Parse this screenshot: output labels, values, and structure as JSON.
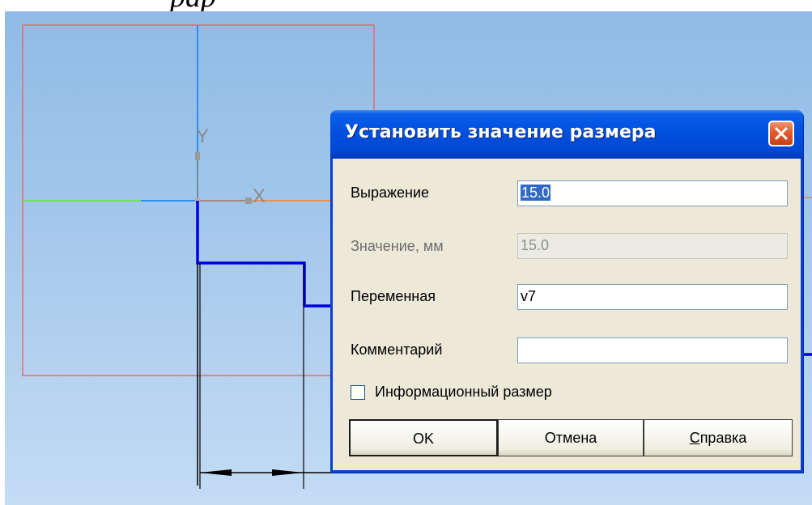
{
  "caption": "рар",
  "dialog": {
    "title": "Установить значение размера",
    "close_icon": "close-icon",
    "fields": {
      "expression": {
        "label": "Выражение",
        "value": "15.0"
      },
      "value_mm": {
        "label": "Значение, мм",
        "value": "15.0"
      },
      "variable": {
        "label": "Переменная",
        "value": "v7"
      },
      "comment": {
        "label": "Комментарий",
        "value": ""
      }
    },
    "info_checkbox": {
      "label": "Информационный размер",
      "checked": false
    },
    "buttons": {
      "ok": "OK",
      "cancel": "Отмена",
      "help": "Справка"
    }
  },
  "axes": {
    "x": "X",
    "y": "Y"
  },
  "colors": {
    "title_bar": "#0052e0",
    "dialog_bg": "#ece9d8",
    "sketch_line": "#0000dd",
    "frame": "#e86a6a",
    "axis_y": "#2d8ef0",
    "axis_x_left": "#6ee05a",
    "axis_x_right": "#f0904a"
  }
}
